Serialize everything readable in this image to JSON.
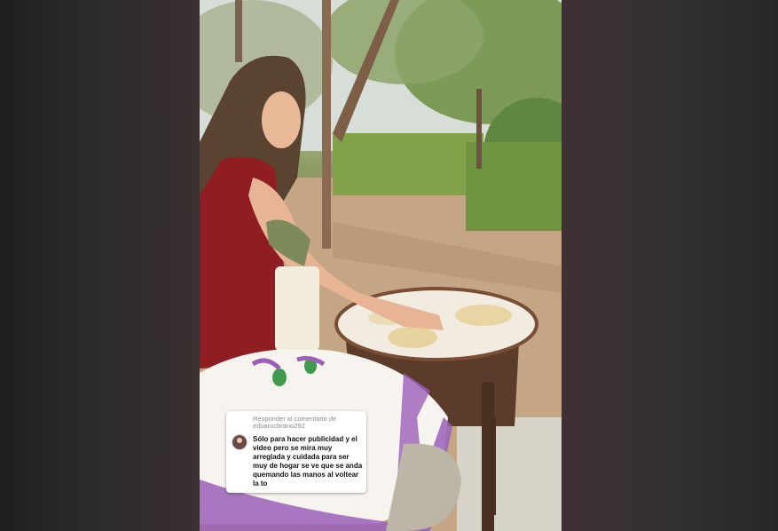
{
  "reply_sticker": {
    "header": "Responder al comentario de eduarocbrano292",
    "comment": "Sólo para hacer publicidad y el video pero se mira muy arreglada y cuidada para ser muy de hogar se ve que se anda quemando las manos al voltear la to"
  },
  "colors": {
    "dress": "#8f1d22",
    "comal": "#f2ece0",
    "embroidery": "#9b5fb8"
  }
}
